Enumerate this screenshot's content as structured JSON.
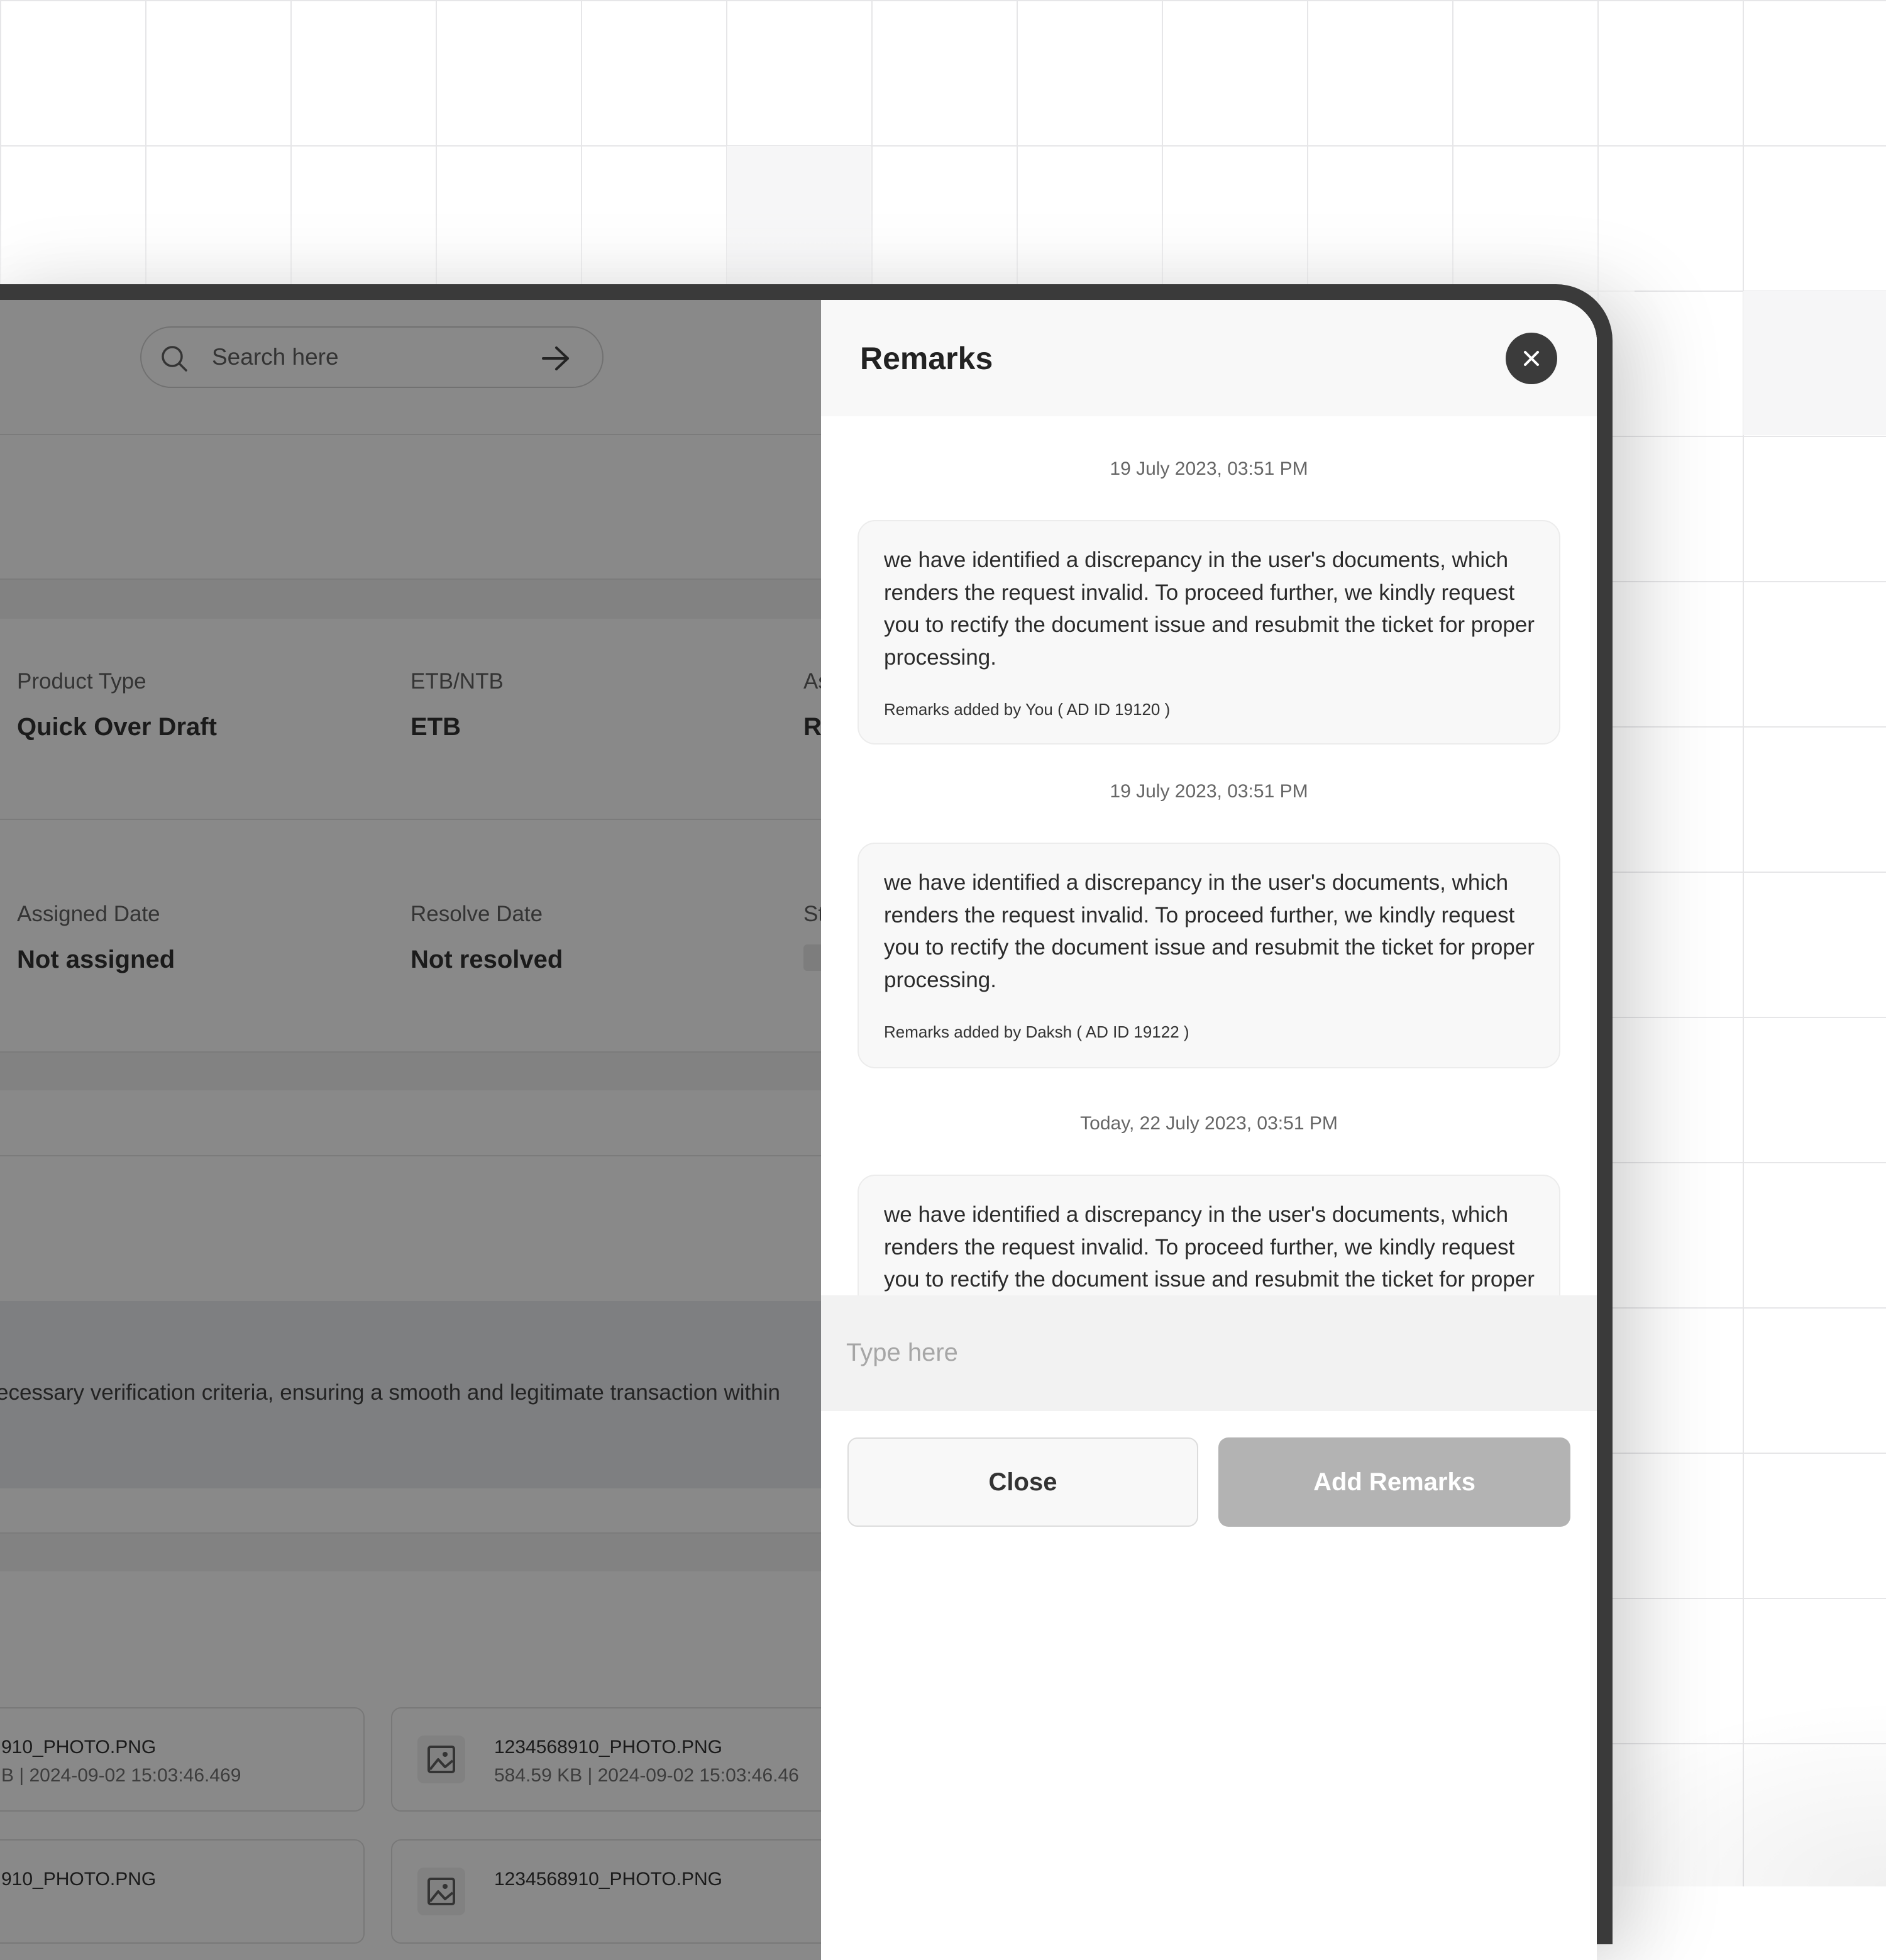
{
  "colors": {
    "overlay": "rgba(20,20,20,0.5)",
    "device_frame": "#3a3a3a",
    "close_button_bg": "#3b3b3b",
    "add_button_bg": "#b3b3b3"
  },
  "background_page": {
    "search": {
      "placeholder": "Search here",
      "icon": "search-icon",
      "submit_icon": "arrow-right-icon"
    },
    "details_row1": [
      {
        "label": "Product Type",
        "value": "Quick Over Draft"
      },
      {
        "label": "ETB/NTB",
        "value": "ETB"
      },
      {
        "label": "As",
        "value": "R"
      }
    ],
    "details_row2": [
      {
        "label": "Assigned Date",
        "value": "Not assigned"
      },
      {
        "label": "Resolve Date",
        "value": "Not resolved"
      },
      {
        "label": "St",
        "value": ""
      }
    ],
    "description_fragment": "ecessary verification criteria, ensuring a smooth and legitimate transaction within",
    "files": [
      {
        "name": "910_PHOTO.PNG",
        "meta": "B | 2024-09-02 15:03:46.469",
        "icon": "image-icon"
      },
      {
        "name": "1234568910_PHOTO.PNG",
        "meta": "584.59 KB | 2024-09-02 15:03:46.46",
        "icon": "image-icon"
      },
      {
        "name": "910_PHOTO.PNG",
        "meta": "",
        "icon": "image-icon"
      },
      {
        "name": "1234568910_PHOTO.PNG",
        "meta": "",
        "icon": "image-icon"
      }
    ]
  },
  "remarks_panel": {
    "title": "Remarks",
    "close_icon": "close-icon",
    "entries": [
      {
        "timestamp": "19 July 2023, 03:51 PM",
        "message": "we have identified a discrepancy in the user's documents, which renders the request invalid. To proceed further, we kindly request you to rectify the document issue and resubmit the ticket for proper processing.",
        "author": "Remarks added by You ( AD ID 19120 )"
      },
      {
        "timestamp": "19 July 2023, 03:51 PM",
        "message": "we have identified a discrepancy in the user's documents, which renders the request invalid. To proceed further, we kindly request you to rectify the document issue and resubmit the ticket for proper processing.",
        "author": "Remarks added by Daksh ( AD ID 19122 )"
      },
      {
        "timestamp": "Today, 22 July 2023, 03:51 PM",
        "message": "we have identified a discrepancy in the user's documents, which renders the request invalid. To proceed further, we kindly request you to rectify the document issue and resubmit the ticket for proper processing.we have identified a discrepancy in the user's documents, which renders the request invalid. To proceed further, we kindly request you to rectify the document issue and resubmit the ticket for proper processing.we have identified a discrepancy in the user's documents, which renders the request invalid. To proceed further, we kindly request you to rectify the document issue and resubmit the ticket for proper processing.we have identified a discrepancy in the user's documents, which renders the request invalid. To proceed further, we kindly request you to rectify the document",
        "author": ""
      }
    ],
    "input_placeholder": "Type here",
    "close_label": "Close",
    "add_label": "Add Remarks"
  }
}
